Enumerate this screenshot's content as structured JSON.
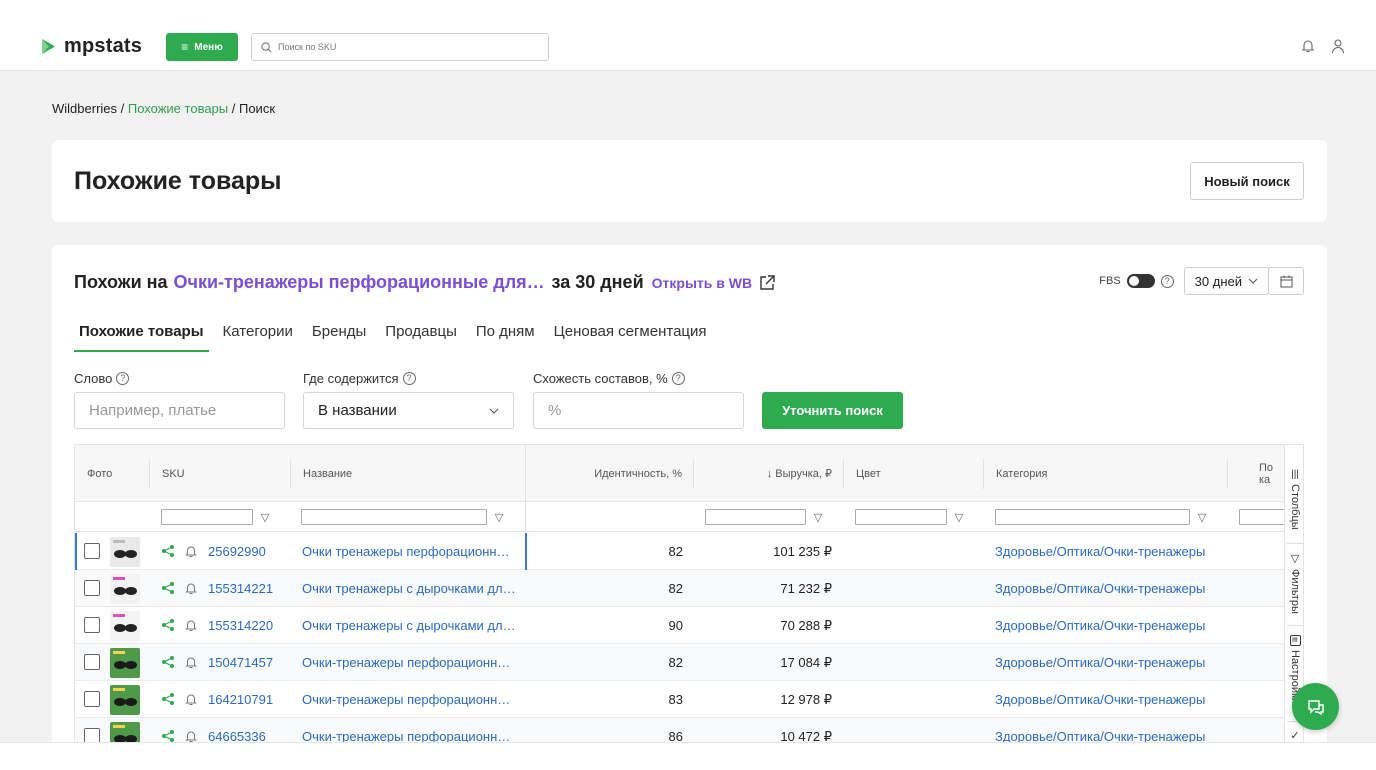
{
  "app": {
    "logo_text": "mpstats",
    "menu_label": "Меню",
    "sku_search_placeholder": "Поиск по SKU",
    "brand_color": "#2eaa4f"
  },
  "breadcrumb": {
    "root": "Wildberries",
    "sep1": " / ",
    "section": "Похожие товары",
    "sep2": " / ",
    "current": "Поиск"
  },
  "header": {
    "title": "Похожие товары",
    "new_search_label": "Новый поиск"
  },
  "summary": {
    "prefix": "Похожи на",
    "product": "Очки-тренажеры перфорационные для з...",
    "period_text": "за 30 дней",
    "open_wb_label": "Открыть в WB",
    "fbs_label": "FBS",
    "fbs_enabled": true,
    "period_select": "30 дней"
  },
  "tabs": [
    {
      "label": "Похожие товары",
      "active": true
    },
    {
      "label": "Категории",
      "active": false
    },
    {
      "label": "Бренды",
      "active": false
    },
    {
      "label": "Продавцы",
      "active": false
    },
    {
      "label": "По дням",
      "active": false
    },
    {
      "label": "Ценовая сегментация",
      "active": false
    }
  ],
  "filters": {
    "word_label": "Слово",
    "word_placeholder": "Например, платье",
    "where_label": "Где содержится",
    "where_value": "В названии",
    "similarity_label": "Схожесть составов, %",
    "similarity_placeholder": "%",
    "refine_label": "Уточнить поиск"
  },
  "table": {
    "columns": {
      "photo": "Фото",
      "sku": "SKU",
      "name": "Название",
      "identity": "Идентичность, %",
      "revenue": "↓ Выручка, ₽",
      "color": "Цвет",
      "category": "Категория",
      "extra": "По ка"
    },
    "rows": [
      {
        "sku": "25692990",
        "name": "Очки тренажеры перфорационные для зрения",
        "identity": "82",
        "revenue": "101 235 ₽",
        "category": "Здоровье/Оптика/Очки-тренажеры",
        "thumb": "grey"
      },
      {
        "sku": "155314221",
        "name": "Очки тренажеры с дырочками для зрения",
        "identity": "82",
        "revenue": "71 232 ₽",
        "category": "Здоровье/Оптика/Очки-тренажеры",
        "thumb": "pink"
      },
      {
        "sku": "155314220",
        "name": "Очки тренажеры с дырочками для зрения",
        "identity": "90",
        "revenue": "70 288 ₽",
        "category": "Здоровье/Оптика/Очки-тренажеры",
        "thumb": "pink"
      },
      {
        "sku": "150471457",
        "name": "Очки-тренажеры перфорационные для зрения",
        "identity": "82",
        "revenue": "17 084 ₽",
        "category": "Здоровье/Оптика/Очки-тренажеры",
        "thumb": "green"
      },
      {
        "sku": "164210791",
        "name": "Очки-тренажеры перфорационные для зрения",
        "identity": "83",
        "revenue": "12 978 ₽",
        "category": "Здоровье/Оптика/Очки-тренажеры",
        "thumb": "green"
      },
      {
        "sku": "64665336",
        "name": "Очки-тренажеры перфорационные для зрения",
        "identity": "86",
        "revenue": "10 472 ₽",
        "category": "Здоровье/Оптика/Очки-тренажеры",
        "thumb": "green"
      }
    ]
  },
  "side_panel": {
    "columns_label": "Столбцы",
    "filters_label": "Фильтры",
    "settings_label": "Настройки"
  },
  "icons": {
    "search": "search-icon",
    "bell": "bell-icon",
    "user": "user-icon",
    "share": "share-icon",
    "external": "external-link-icon",
    "calendar": "calendar-icon",
    "chat": "chat-icon"
  }
}
